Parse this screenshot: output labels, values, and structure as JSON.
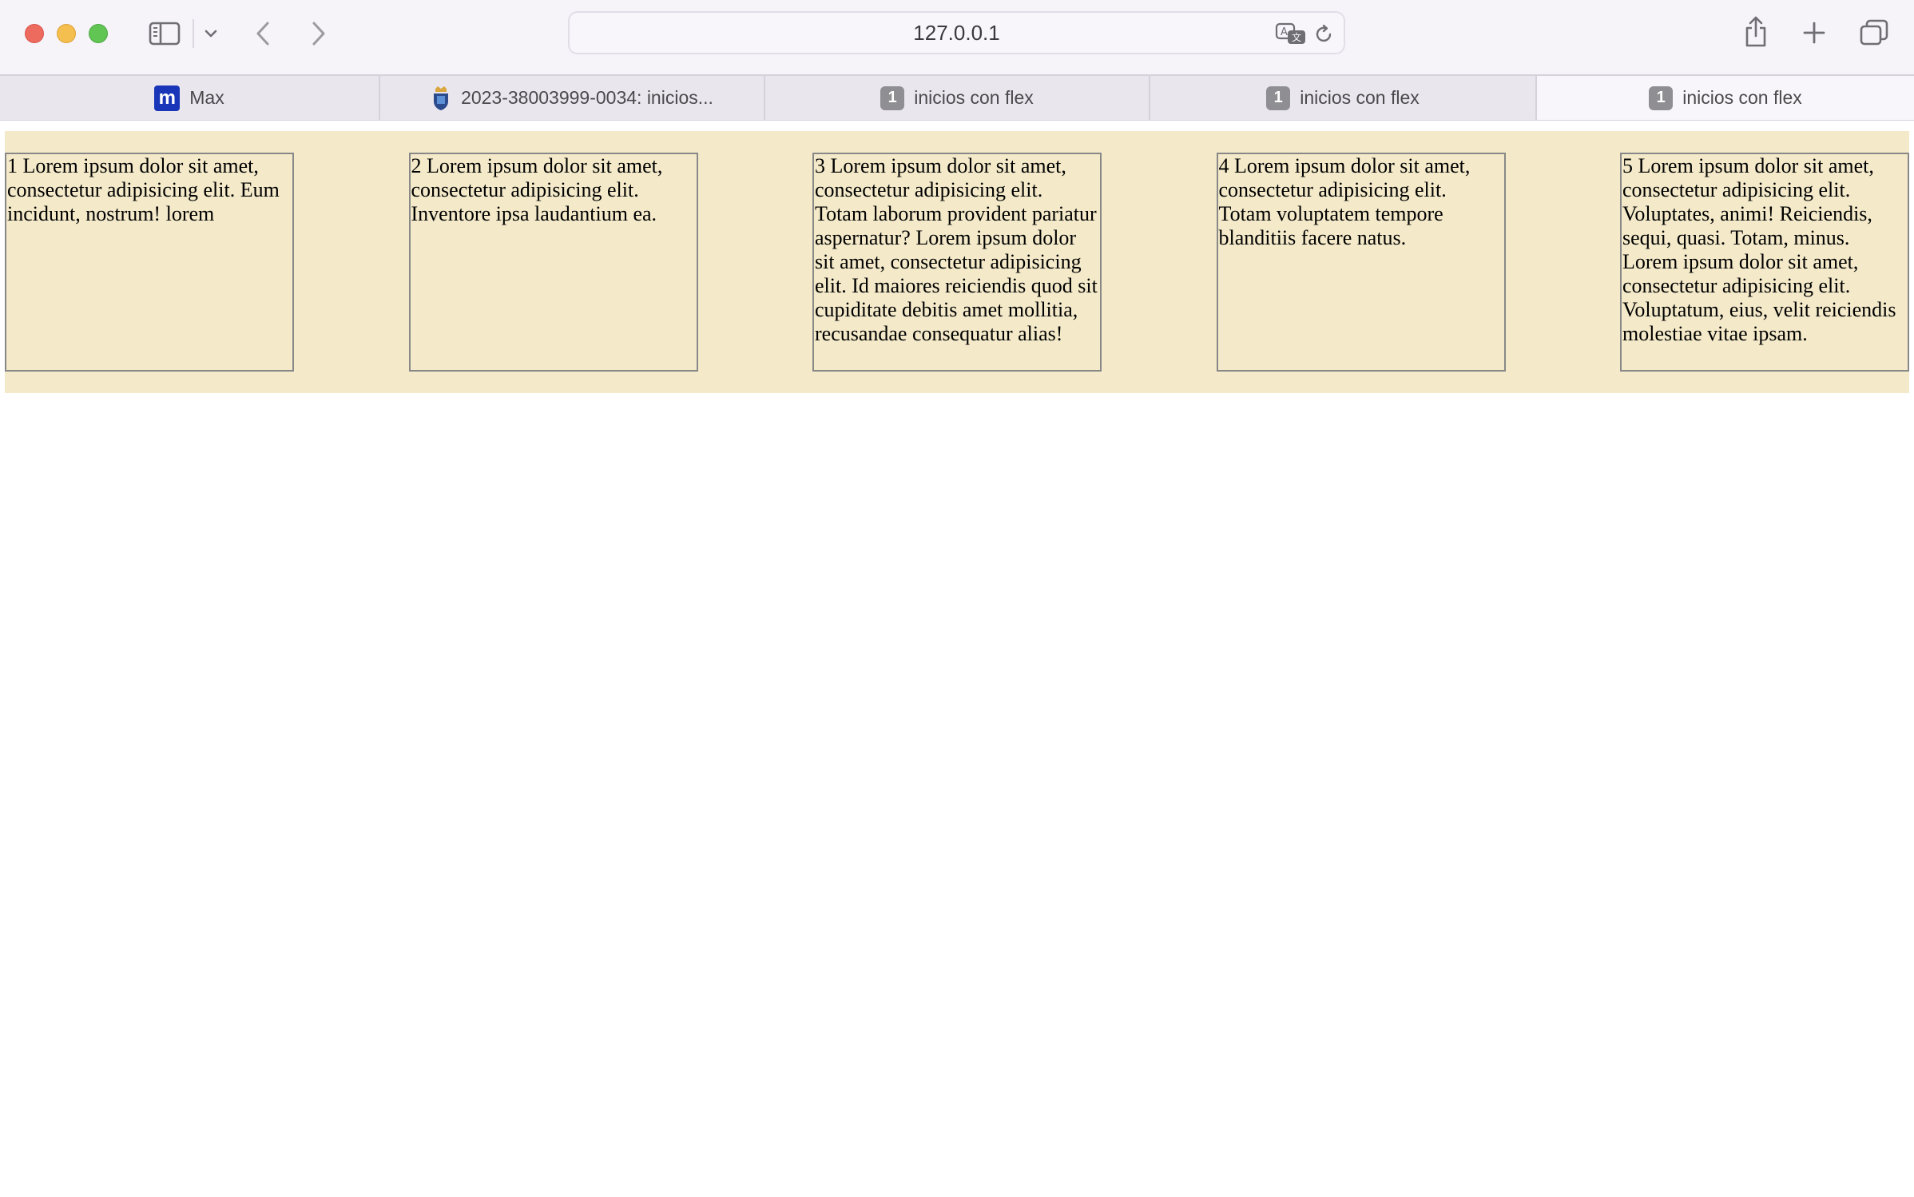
{
  "window": {
    "address_url": "127.0.0.1"
  },
  "toolbar": {
    "icons": [
      "sidebar-icon",
      "chevron-down-icon",
      "back-icon",
      "forward-icon",
      "translate-icon",
      "reload-icon",
      "share-icon",
      "new-tab-icon",
      "tab-overview-icon"
    ]
  },
  "tabs": [
    {
      "label": "Max",
      "favicon": "m",
      "active": false
    },
    {
      "label": "2023-38003999-0034: inicios...",
      "favicon": "crest",
      "active": false
    },
    {
      "label": "inicios con flex",
      "favicon": "1",
      "active": false
    },
    {
      "label": "inicios con flex",
      "favicon": "1",
      "active": false
    },
    {
      "label": "inicios con flex",
      "favicon": "1",
      "active": true
    }
  ],
  "page": {
    "items": [
      "1 Lorem ipsum dolor sit amet, consectetur adipisicing elit. Eum incidunt, nostrum! lorem",
      "2 Lorem ipsum dolor sit amet, consectetur adipisicing elit. Inventore ipsa laudantium ea.",
      "3 Lorem ipsum dolor sit amet, consectetur adipisicing elit. Totam laborum provident pariatur aspernatur? Lorem ipsum dolor sit amet, consectetur adipisicing elit. Id maiores reiciendis quod sit cupiditate debitis amet mollitia, recusandae consequatur alias!",
      "4 Lorem ipsum dolor sit amet, consectetur adipisicing elit. Totam voluptatem tempore blanditiis facere natus.",
      "5 Lorem ipsum dolor sit amet, consectetur adipisicing elit. Voluptates, animi! Reiciendis, sequi, quasi. Totam, minus. Lorem ipsum dolor sit amet, consectetur adipisicing elit. Voluptatum, eius, velit reiciendis molestiae vitae ipsam."
    ]
  },
  "colors": {
    "container_bg": "#f4eaca",
    "item_border": "#888888",
    "toolbar_bg": "#f6f3f9",
    "tabbar_bg": "#e9e6ed"
  }
}
